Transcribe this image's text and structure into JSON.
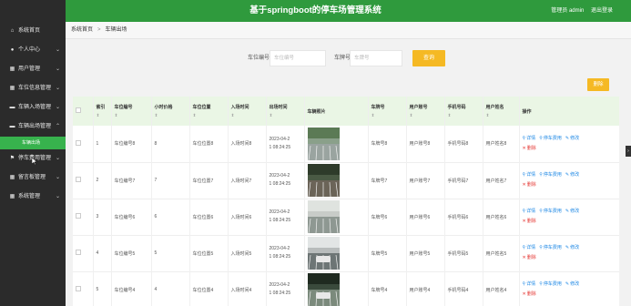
{
  "header": {
    "title": "基于springboot的停车场管理系统",
    "user_label": "管理员 admin",
    "logout_label": "退出登录"
  },
  "sidebar": {
    "items": [
      {
        "icon": "home-icon",
        "label": "系统首页",
        "has_arrow": false
      },
      {
        "icon": "user-icon",
        "label": "个人中心",
        "has_arrow": true
      },
      {
        "icon": "grid-icon",
        "label": "用户管理",
        "has_arrow": true
      },
      {
        "icon": "grid-icon",
        "label": "车位信息管理",
        "has_arrow": true
      },
      {
        "icon": "car-icon",
        "label": "车辆入场管理",
        "has_arrow": true
      },
      {
        "icon": "car-icon",
        "label": "车辆出场管理",
        "has_arrow": true
      },
      {
        "icon": "flag-icon",
        "label": "停车费用管理",
        "has_arrow": true
      },
      {
        "icon": "grid-icon",
        "label": "留言板管理",
        "has_arrow": true
      },
      {
        "icon": "grid-icon",
        "label": "系统管理",
        "has_arrow": true
      }
    ],
    "sub_item": "车辆出场"
  },
  "breadcrumb": {
    "home": "系统首页",
    "separator": ">",
    "current": "车辆出场"
  },
  "search": {
    "spot_label": "车位编号",
    "spot_placeholder": "车位编号",
    "plate_label": "车牌号",
    "plate_placeholder": "车牌号",
    "button": "查询"
  },
  "toolbar": {
    "delete_label": "删除"
  },
  "table": {
    "headers": [
      "",
      "索引",
      "车位编号",
      "小时价格",
      "车位位置",
      "入场时间",
      "出场时间",
      "车辆照片",
      "车牌号",
      "用户账号",
      "手机号码",
      "用户姓名",
      "操作"
    ],
    "sort_glyph": "⇕",
    "rows": [
      {
        "index": "1",
        "spot_no": "车位编号8",
        "price": "8",
        "location": "车位位置8",
        "entry": "入场时间8",
        "exit_line1": "2023-04-2",
        "exit_line2": "1 08:24:25",
        "plate": "车牌号8",
        "account": "用户账号8",
        "phone": "手机号码8",
        "name": "用户姓名8"
      },
      {
        "index": "2",
        "spot_no": "车位编号7",
        "price": "7",
        "location": "车位位置7",
        "entry": "入场时间7",
        "exit_line1": "2023-04-2",
        "exit_line2": "1 08:24:25",
        "plate": "车牌号7",
        "account": "用户账号7",
        "phone": "手机号码7",
        "name": "用户姓名7"
      },
      {
        "index": "3",
        "spot_no": "车位编号6",
        "price": "6",
        "location": "车位位置6",
        "entry": "入场时间6",
        "exit_line1": "2023-04-2",
        "exit_line2": "1 08:24:25",
        "plate": "车牌号6",
        "account": "用户账号6",
        "phone": "手机号码6",
        "name": "用户姓名6"
      },
      {
        "index": "4",
        "spot_no": "车位编号5",
        "price": "5",
        "location": "车位位置5",
        "entry": "入场时间5",
        "exit_line1": "2023-04-2",
        "exit_line2": "1 08:24:25",
        "plate": "车牌号5",
        "account": "用户账号5",
        "phone": "手机号码5",
        "name": "用户姓名5"
      },
      {
        "index": "5",
        "spot_no": "车位编号4",
        "price": "4",
        "location": "车位位置4",
        "entry": "入场时间4",
        "exit_line1": "2023-04-2",
        "exit_line2": "1 08:24:25",
        "plate": "车牌号4",
        "account": "用户账号4",
        "phone": "手机号码4",
        "name": "用户姓名4"
      }
    ],
    "ops": {
      "detail": "详情",
      "fee": "停车费用",
      "edit": "修改",
      "delete": "删除"
    }
  },
  "colors": {
    "header_bg": "#2f9a3d",
    "sidebar_bg": "#2b2b2b",
    "active_sub": "#37b24d",
    "button": "#f5b924",
    "table_head": "#eaf6e5"
  }
}
